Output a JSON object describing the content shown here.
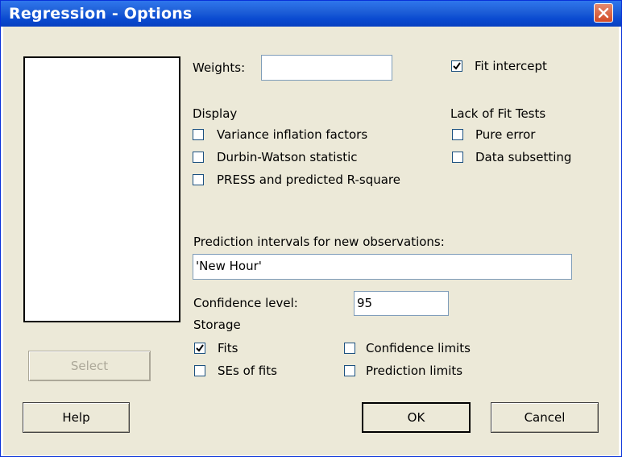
{
  "window": {
    "title": "Regression - Options"
  },
  "weights": {
    "label": "Weights:",
    "value": ""
  },
  "fit_intercept": {
    "label": "Fit intercept",
    "checked": true
  },
  "display": {
    "heading": "Display",
    "items": [
      {
        "label": "Variance inflation factors",
        "checked": false
      },
      {
        "label": "Durbin-Watson statistic",
        "checked": false
      },
      {
        "label": "PRESS and predicted R-square",
        "checked": false
      }
    ]
  },
  "lack_of_fit": {
    "heading": "Lack of Fit Tests",
    "items": [
      {
        "label": "Pure error",
        "checked": false
      },
      {
        "label": "Data subsetting",
        "checked": false
      }
    ]
  },
  "prediction": {
    "label": "Prediction intervals for new observations:",
    "value": "'New Hour'"
  },
  "confidence": {
    "label": "Confidence level:",
    "value": "95"
  },
  "storage": {
    "heading": "Storage",
    "items": [
      {
        "label": "Fits",
        "checked": true
      },
      {
        "label": "SEs of fits",
        "checked": false
      },
      {
        "label": "Confidence limits",
        "checked": false
      },
      {
        "label": "Prediction limits",
        "checked": false
      }
    ]
  },
  "buttons": {
    "select": "Select",
    "help": "Help",
    "ok": "OK",
    "cancel": "Cancel"
  },
  "colors": {
    "titlebar": "#1f60d8",
    "dialog_bg": "#ece9d8",
    "close_button": "#d24a26"
  }
}
